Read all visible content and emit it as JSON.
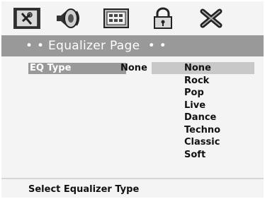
{
  "icons": [
    {
      "name": "general-setup-icon"
    },
    {
      "name": "speaker-setup-icon"
    },
    {
      "name": "video-setup-icon"
    },
    {
      "name": "password-lock-icon"
    },
    {
      "name": "exit-icon"
    }
  ],
  "title": "• • Equalizer Page  • •",
  "setting": {
    "label": "EQ Type",
    "value": "None"
  },
  "options": [
    "None",
    "Rock",
    "Pop",
    "Live",
    "Dance",
    "Techno",
    "Classic",
    "Soft"
  ],
  "selected_option": "None",
  "status": "Select Equalizer Type"
}
